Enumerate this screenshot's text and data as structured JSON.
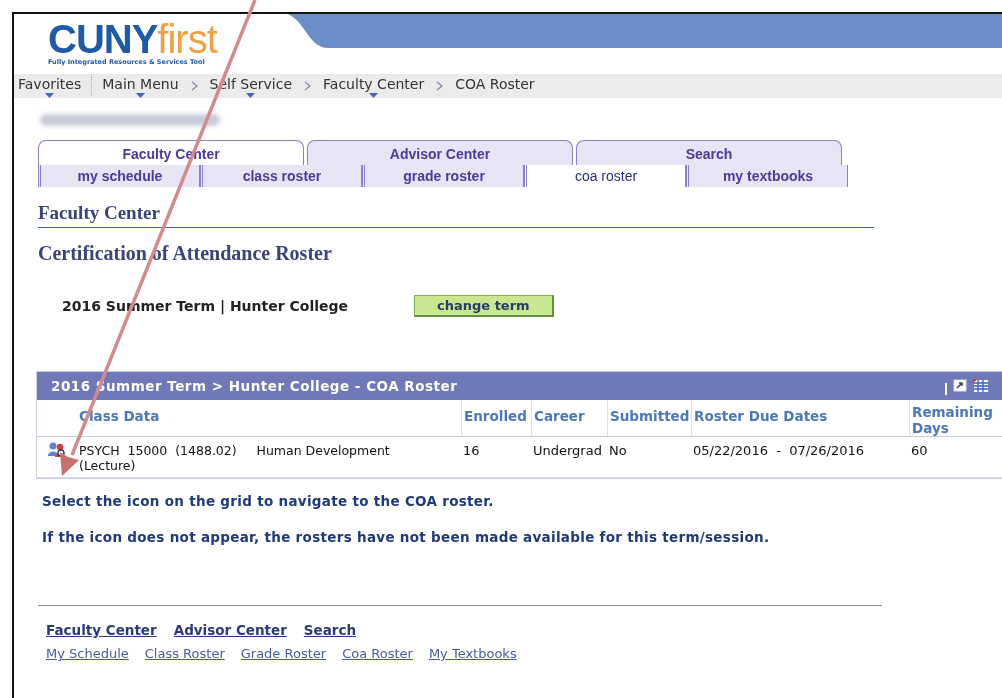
{
  "logo": {
    "part1": "CUNY",
    "part2": "first",
    "tagline": "Fully Integrated Resources & Services Tool"
  },
  "breadcrumbs": [
    {
      "label": "Favorites",
      "dropdown": true
    },
    {
      "label": "Main Menu",
      "dropdown": true
    },
    {
      "label": "Self Service",
      "dropdown": true
    },
    {
      "label": "Faculty Center",
      "dropdown": true
    },
    {
      "label": "COA Roster",
      "dropdown": false
    }
  ],
  "tabs": [
    {
      "label": "Faculty Center",
      "selected": true
    },
    {
      "label": "Advisor Center",
      "selected": false
    },
    {
      "label": "Search",
      "selected": false
    }
  ],
  "subtabs": [
    {
      "label": "my schedule",
      "selected": false
    },
    {
      "label": "class roster",
      "selected": false
    },
    {
      "label": "grade roster",
      "selected": false
    },
    {
      "label": "coa roster",
      "selected": true
    },
    {
      "label": "my textbooks",
      "selected": false
    }
  ],
  "section_heading": "Faculty Center",
  "page_title": "Certification of Attendance Roster",
  "term": {
    "label": "2016 Summer Term | Hunter College",
    "button": "change term"
  },
  "grid": {
    "title": "2016 Summer Term > Hunter College - COA Roster",
    "columns": [
      "Class Data",
      "Enrolled",
      "Career",
      "Submitted",
      "Roster Due Dates",
      "Remaining Days"
    ],
    "rows": [
      {
        "class_data": "PSYCH  15000  (1488.02)     Human Development (Lecture)",
        "enrolled": "16",
        "career": "Undergrad",
        "submitted": "No",
        "due_dates": "05/22/2016  -  07/26/2016",
        "remaining_days": "60"
      }
    ]
  },
  "messages": [
    "Select the icon on the grid to navigate to the COA roster.",
    "If the icon does not appear, the rosters have not been made available for this term/session."
  ],
  "footer_links": [
    [
      "Faculty Center",
      "Advisor Center",
      "Search"
    ],
    [
      "My Schedule",
      "Class Roster",
      "Grade Roster",
      "Coa Roster",
      "My Textbooks"
    ]
  ]
}
